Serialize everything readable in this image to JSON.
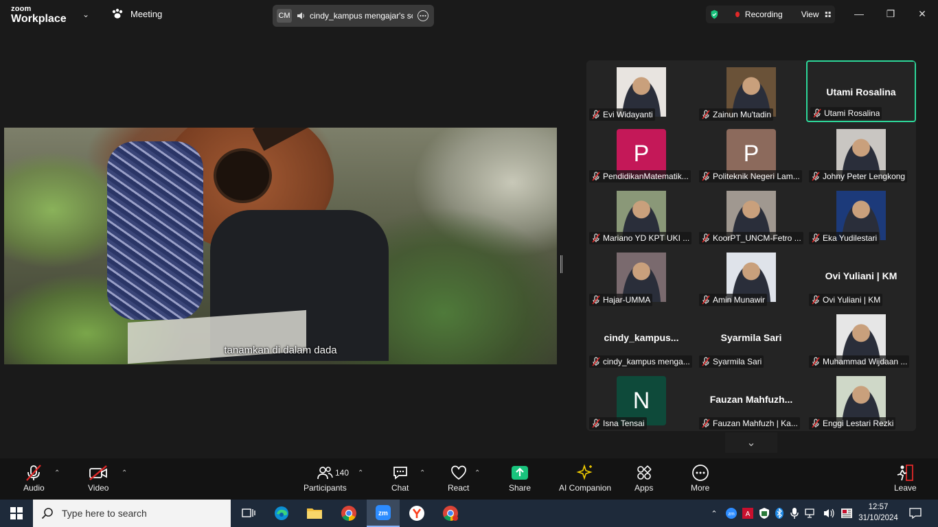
{
  "app": {
    "logo_line1": "zoom",
    "logo_line2": "Workplace"
  },
  "header": {
    "meeting_label": "Meeting",
    "share_badge": "CM",
    "share_title": "cindy_kampus mengajar's screen",
    "recording_label": "Recording",
    "view_label": "View"
  },
  "stage": {
    "subtitle": "tanamkan di dalam dada"
  },
  "participants": [
    {
      "name": "Evi Widayanti",
      "kind": "photo",
      "tone": "#e8e4e0"
    },
    {
      "name": "Zainun Mu'tadin",
      "kind": "photo",
      "tone": "#6a5238"
    },
    {
      "name": "Utami Rosalina",
      "kind": "name",
      "big": "Utami Rosalina",
      "active": true
    },
    {
      "name": "PendidikanMatematik...",
      "kind": "avatar",
      "letter": "P",
      "color": "#c41858"
    },
    {
      "name": "Politeknik Negeri Lam...",
      "kind": "avatar",
      "letter": "P",
      "color": "#8c6a5c"
    },
    {
      "name": "Johny Peter Lengkong",
      "kind": "photo",
      "tone": "#c9c6c2"
    },
    {
      "name": "Mariano YD KPT UKI ...",
      "kind": "photo",
      "tone": "#8a9878"
    },
    {
      "name": "KoorPT_UNCM-Fetro ...",
      "kind": "photo",
      "tone": "#a09890"
    },
    {
      "name": "Eka Yudilestari",
      "kind": "photo",
      "tone": "#1c3a7a"
    },
    {
      "name": "Hajar-UMMA",
      "kind": "photo",
      "tone": "#7a6a6e"
    },
    {
      "name": "Amin Munawir",
      "kind": "photo",
      "tone": "#dfe3ea"
    },
    {
      "name": "Ovi Yuliani | KM",
      "kind": "name",
      "big": "Ovi Yuliani | KM"
    },
    {
      "name": "cindy_kampus menga...",
      "kind": "name",
      "big": "cindy_kampus..."
    },
    {
      "name": "Syarmila Sari",
      "kind": "name",
      "big": "Syarmila Sari"
    },
    {
      "name": "Muhammad Wijdaan ...",
      "kind": "photo",
      "tone": "#e6e6e6"
    },
    {
      "name": "Isna Tensai",
      "kind": "avatar",
      "letter": "N",
      "color": "#0e4a3a"
    },
    {
      "name": "Fauzan Mahfuzh | Ka...",
      "kind": "name",
      "big": "Fauzan  Mahfuzh..."
    },
    {
      "name": "Enggi Lestari Rezki",
      "kind": "photo",
      "tone": "#cfd8c8"
    }
  ],
  "toolbar": {
    "audio": "Audio",
    "video": "Video",
    "participants": "Participants",
    "participants_count": "140",
    "chat": "Chat",
    "react": "React",
    "share": "Share",
    "ai": "AI Companion",
    "apps": "Apps",
    "more": "More",
    "leave": "Leave"
  },
  "taskbar": {
    "search_placeholder": "Type here to search",
    "time": "12:57",
    "date": "31/10/2024"
  },
  "colors": {
    "accent_green": "#2dd89a",
    "recording_red": "#e02828",
    "share_green": "#19c37d",
    "mute_red": "#e02828"
  }
}
